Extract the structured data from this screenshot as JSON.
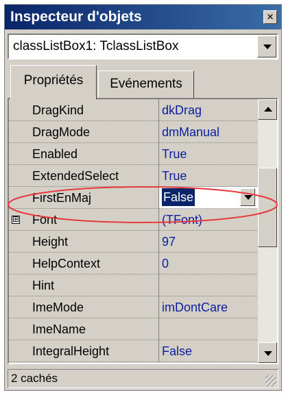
{
  "window": {
    "title": "Inspecteur d'objets",
    "close_icon": "x-icon"
  },
  "selector": {
    "value": "classListBox1: TclassListBox"
  },
  "tabs": [
    {
      "label": "Propriétés",
      "active": true
    },
    {
      "label": "Evénements",
      "active": false
    }
  ],
  "properties": [
    {
      "name": "DragKind",
      "value": "dkDrag"
    },
    {
      "name": "DragMode",
      "value": "dmManual"
    },
    {
      "name": "Enabled",
      "value": "True"
    },
    {
      "name": "ExtendedSelect",
      "value": "True"
    },
    {
      "name": "FirstEnMaj",
      "value": "False",
      "editing": true
    },
    {
      "name": "Font",
      "value": "(TFont)",
      "expandable": true
    },
    {
      "name": "Height",
      "value": "97"
    },
    {
      "name": "HelpContext",
      "value": "0"
    },
    {
      "name": "Hint",
      "value": ""
    },
    {
      "name": "ImeMode",
      "value": "imDontCare"
    },
    {
      "name": "ImeName",
      "value": ""
    },
    {
      "name": "IntegralHeight",
      "value": "False"
    }
  ],
  "expand_glyph": "⊞",
  "status": {
    "text": "2 cachés"
  },
  "colors": {
    "title_bar": "#0a246a",
    "value_text": "#0a1e9e",
    "highlight": "#e8383b"
  }
}
